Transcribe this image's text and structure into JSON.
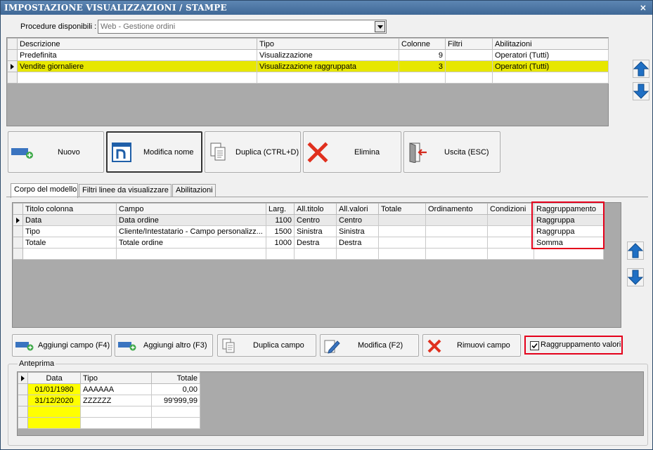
{
  "window": {
    "title": "IMPOSTAZIONE VISUALIZZAZIONI / STAMPE",
    "close": "×"
  },
  "procedure": {
    "label": "Procedure disponibili :",
    "value": "Web - Gestione ordini"
  },
  "models_grid": {
    "columns": [
      "Descrizione",
      "Tipo",
      "Colonne",
      "Filtri",
      "Abilitazioni"
    ],
    "rows": [
      [
        "Predefinita",
        "Visualizzazione",
        "9",
        "",
        "Operatori (Tutti)"
      ],
      [
        "Vendite giornaliere",
        "Visualizzazione raggruppata",
        "3",
        "",
        "Operatori (Tutti)"
      ]
    ]
  },
  "toolbar": {
    "new": "Nuovo",
    "rename": "Modifica nome",
    "duplicate": "Duplica (CTRL+D)",
    "delete": "Elimina",
    "exit": "Uscita (ESC)"
  },
  "tabs": [
    "Corpo del modello",
    "Filtri linee da visualizzare",
    "Abilitazioni"
  ],
  "fields_grid": {
    "columns": [
      "Titolo colonna",
      "Campo",
      "Larg.",
      "All.titolo",
      "All.valori",
      "Totale",
      "Ordinamento",
      "Condizioni",
      "Raggruppamento"
    ],
    "rows": [
      [
        "Data",
        "Data ordine",
        "1100",
        "Centro",
        "Centro",
        "",
        "",
        "",
        "Raggruppa"
      ],
      [
        "Tipo",
        "Cliente/Intestatario - Campo personalizz...",
        "1500",
        "Sinistra",
        "Sinistra",
        "",
        "",
        "",
        "Raggruppa"
      ],
      [
        "Totale",
        "Totale ordine",
        "1000",
        "Destra",
        "Destra",
        "",
        "",
        "",
        "Somma"
      ]
    ]
  },
  "field_buttons": {
    "add_field": "Aggiungi campo (F4)",
    "add_other": "Aggiungi altro (F3)",
    "duplicate_field": "Duplica campo",
    "edit": "Modifica (F2)",
    "remove": "Rimuovi campo",
    "grouping_checkbox": "Raggruppamento valori"
  },
  "preview": {
    "label": "Anteprima",
    "columns": [
      "Data",
      "Tipo",
      "Totale"
    ],
    "rows": [
      [
        "01/01/1980",
        "AAAAAA",
        "0,00"
      ],
      [
        "31/12/2020",
        "ZZZZZZ",
        "99'999,99"
      ]
    ]
  },
  "colors": {
    "highlight": "#e7e700",
    "preview_yellow": "#ffff00",
    "red_outline": "#e4001b",
    "title_bar": "#4a74a3"
  }
}
